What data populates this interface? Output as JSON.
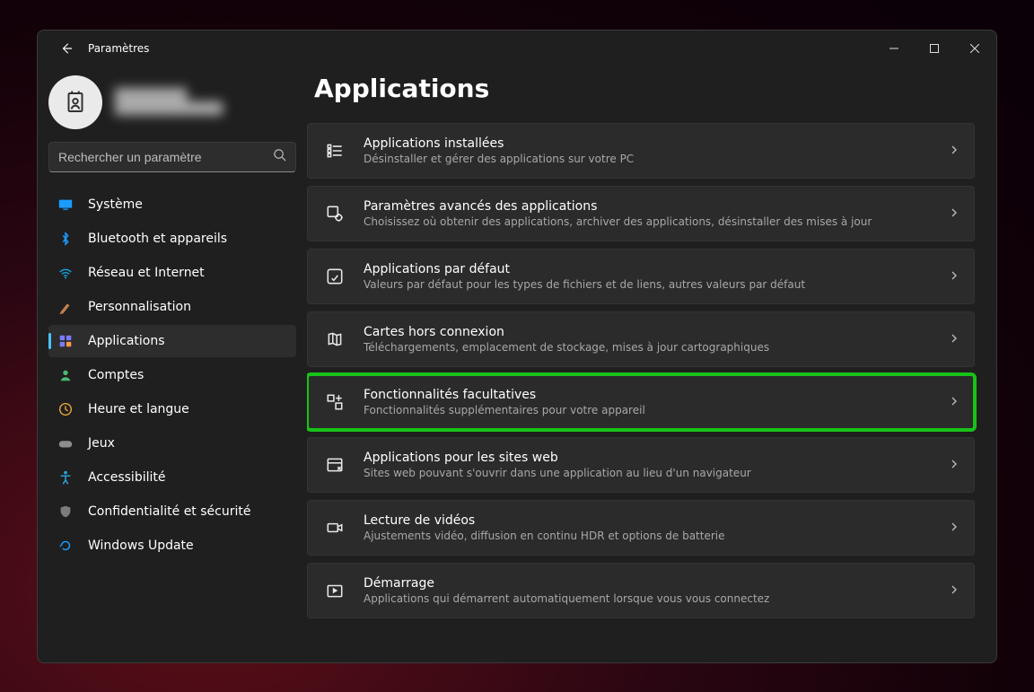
{
  "window": {
    "title": "Paramètres"
  },
  "search": {
    "placeholder": "Rechercher un paramètre"
  },
  "sidebar": {
    "items": [
      {
        "label": "Système",
        "icon": "monitor",
        "color": "#1a9cff"
      },
      {
        "label": "Bluetooth et appareils",
        "icon": "bluetooth",
        "color": "#1a9cff"
      },
      {
        "label": "Réseau et Internet",
        "icon": "wifi",
        "color": "#1aa0d8"
      },
      {
        "label": "Personnalisation",
        "icon": "brush",
        "color": "#c08050"
      },
      {
        "label": "Applications",
        "icon": "apps",
        "color": "#7a7aff",
        "active": true
      },
      {
        "label": "Comptes",
        "icon": "person",
        "color": "#4ab96f"
      },
      {
        "label": "Heure et langue",
        "icon": "clock",
        "color": "#e8a33d"
      },
      {
        "label": "Jeux",
        "icon": "gamepad",
        "color": "#8e8e8e"
      },
      {
        "label": "Accessibilité",
        "icon": "accessibility",
        "color": "#2aa7e1"
      },
      {
        "label": "Confidentialité et sécurité",
        "icon": "shield",
        "color": "#7c7c7c"
      },
      {
        "label": "Windows Update",
        "icon": "update",
        "color": "#1a9cff"
      }
    ]
  },
  "page": {
    "title": "Applications",
    "cards": [
      {
        "title": "Applications installées",
        "sub": "Désinstaller et gérer des applications sur votre PC",
        "icon": "list"
      },
      {
        "title": "Paramètres avancés des applications",
        "sub": "Choisissez où obtenir des applications, archiver des applications, désinstaller des mises à jour",
        "icon": "gear-app"
      },
      {
        "title": "Applications par défaut",
        "sub": "Valeurs par défaut pour les types de fichiers et de liens, autres valeurs par défaut",
        "icon": "default-app"
      },
      {
        "title": "Cartes hors connexion",
        "sub": "Téléchargements, emplacement de stockage, mises à jour cartographiques",
        "icon": "map"
      },
      {
        "title": "Fonctionnalités facultatives",
        "sub": "Fonctionnalités supplémentaires pour votre appareil",
        "icon": "features",
        "highlight": true
      },
      {
        "title": "Applications pour les sites web",
        "sub": "Sites web pouvant s'ouvrir dans une application au lieu d'un navigateur",
        "icon": "web-app"
      },
      {
        "title": "Lecture de vidéos",
        "sub": "Ajustements vidéo, diffusion en continu HDR et options de batterie",
        "icon": "video"
      },
      {
        "title": "Démarrage",
        "sub": "Applications qui démarrent automatiquement lorsque vous vous connectez",
        "icon": "startup"
      }
    ]
  }
}
